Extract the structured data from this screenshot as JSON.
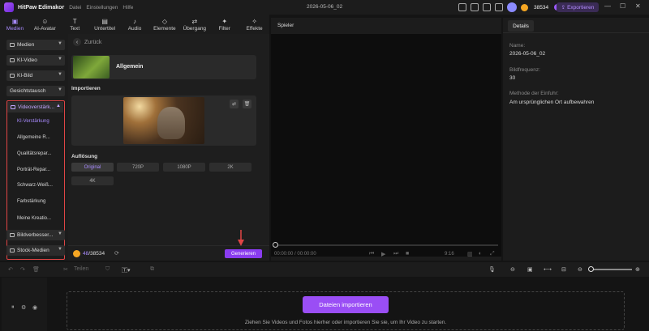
{
  "titlebar": {
    "app_name": "HitPaw Edimakor",
    "menu": [
      "Datei",
      "Einstellungen",
      "Hilfe"
    ],
    "project_name": "2026-05-06_02",
    "credits": "38534",
    "export_label": "Exportieren",
    "window_controls": [
      "—",
      "☐",
      "✕"
    ]
  },
  "tools": [
    {
      "label": "Medien",
      "icon": "folder-icon"
    },
    {
      "label": "AI-Avatar",
      "icon": "avatar-icon"
    },
    {
      "label": "Text",
      "icon": "text-icon"
    },
    {
      "label": "Untertitel",
      "icon": "subtitle-icon"
    },
    {
      "label": "Audio",
      "icon": "audio-icon"
    },
    {
      "label": "Elemente",
      "icon": "elements-icon"
    },
    {
      "label": "Übergang",
      "icon": "transition-icon"
    },
    {
      "label": "Filter",
      "icon": "filter-icon"
    },
    {
      "label": "Effekte",
      "icon": "effects-icon"
    }
  ],
  "sidebar": {
    "items_top": [
      "Medien",
      "KI-Video",
      "KI-Bild",
      "Gesichtstausch"
    ],
    "group_label": "Videoverstärk...",
    "group_items": [
      "KI-Verstärkung",
      "Allgemeine R...",
      "Qualitätsrepar...",
      "Porträt-Repar...",
      "Schwarz-Weiß...",
      "Farbstärkung",
      "Meine Kreatio..."
    ],
    "items_bottom": [
      "Bildverbesser...",
      "Stock-Medien"
    ]
  },
  "panel": {
    "back_label": "Zurück",
    "model_title": "Allgemein",
    "import_section": "Importieren",
    "resolution_section": "Auflösung",
    "resolutions": [
      "Original",
      "720P",
      "1080P",
      "2K",
      "4K"
    ],
    "credits_used": "48",
    "credits_total": "/38534",
    "generate_label": "Generieren"
  },
  "player": {
    "label": "Spieler",
    "current_time": "00:00:00 / 00:00:00",
    "ratio": "9:16"
  },
  "details": {
    "tab": "Details",
    "name_label": "Name:",
    "name_value": "2026-05-06_02",
    "fps_label": "Bildfrequenz:",
    "fps_value": "30",
    "import_method_label": "Methode der Einfuhr:",
    "import_method_value": "Am ursprünglichen Ort aufbewahren"
  },
  "timeline": {
    "split_label": "Teilen",
    "import_button": "Dateien importieren",
    "drop_hint": "Ziehen Sie Videos und Fotos hierher oder importieren Sie sie, um Ihr Video zu starten."
  }
}
